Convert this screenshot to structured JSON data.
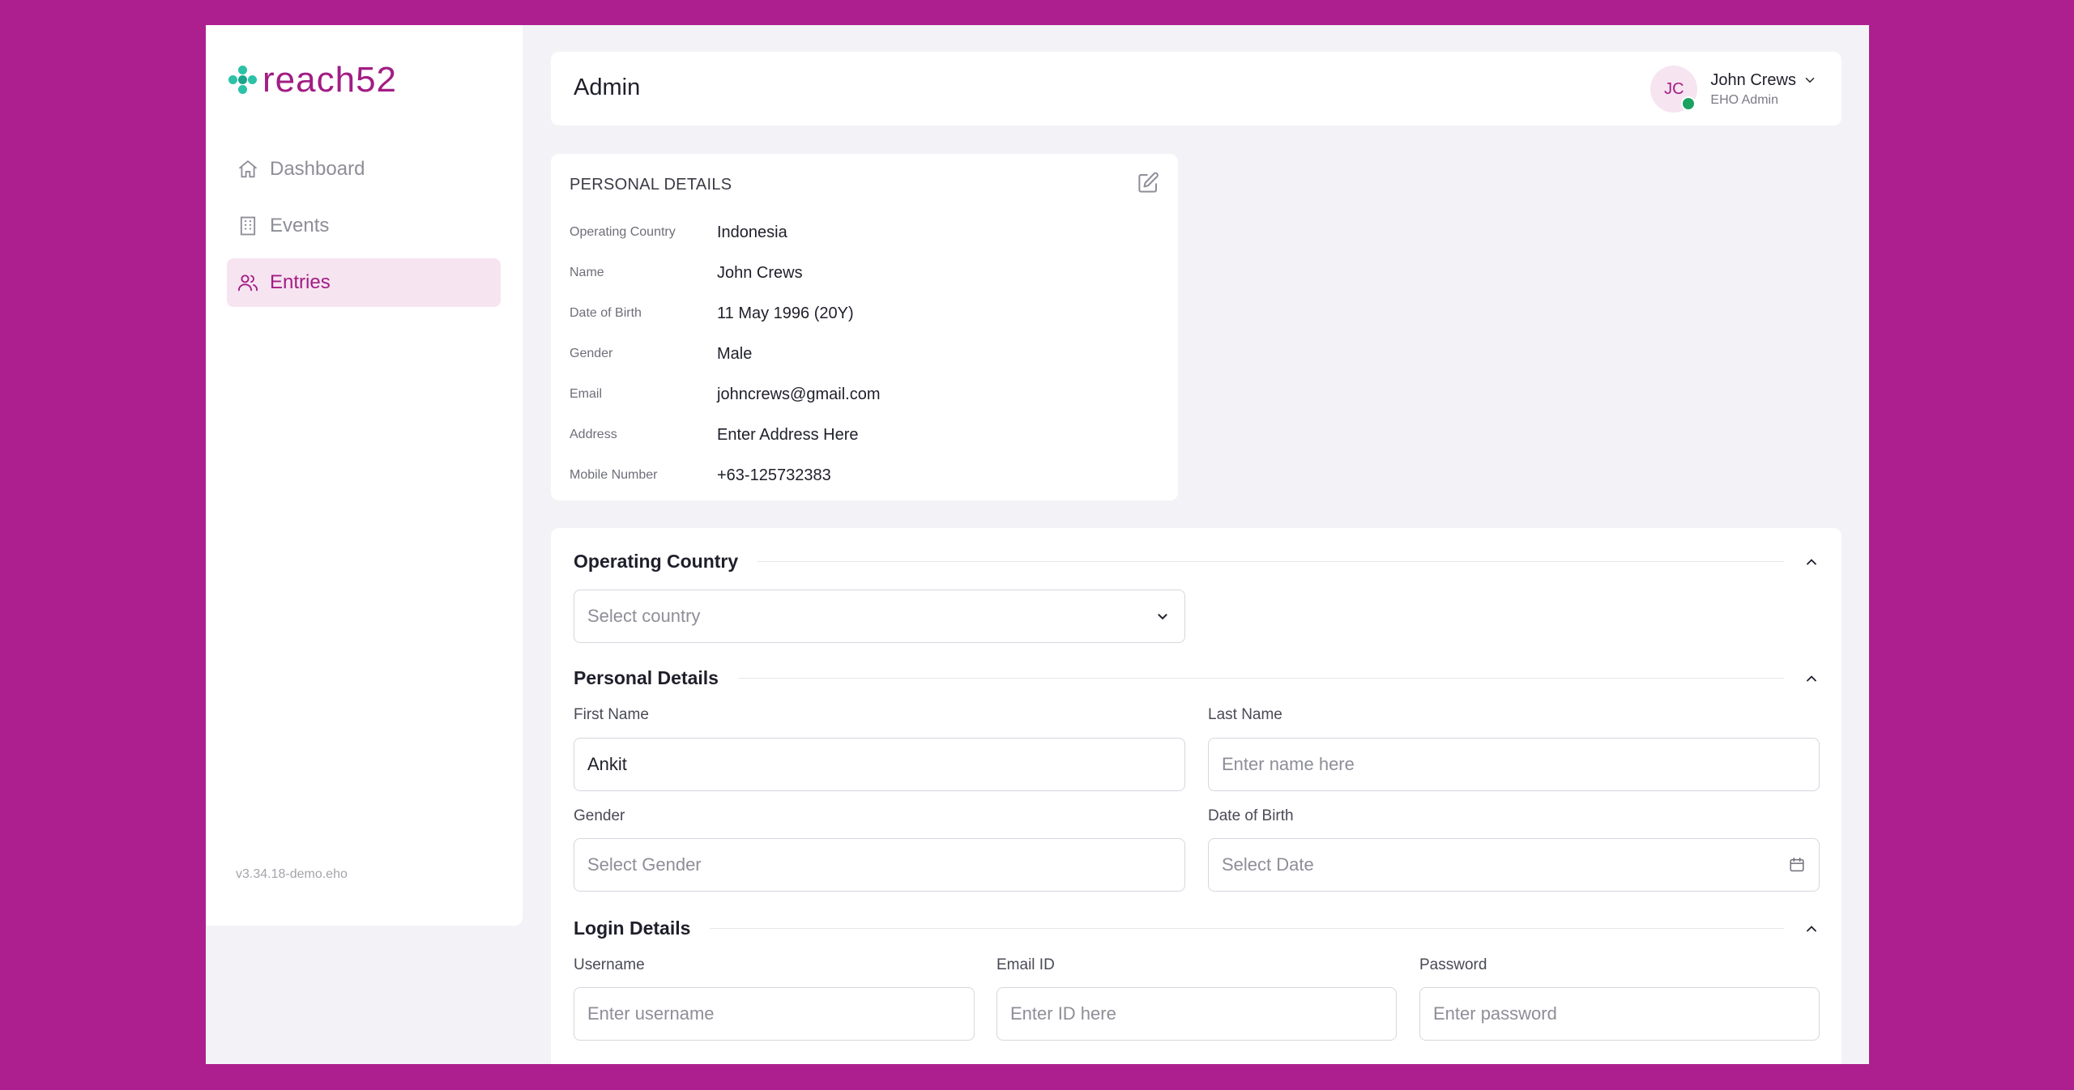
{
  "brand": {
    "name": "reach52",
    "accent": "#a21d84",
    "mark_color": "#2bc2a7"
  },
  "sidebar": {
    "items": [
      {
        "label": "Dashboard",
        "icon": "home-icon",
        "active": false
      },
      {
        "label": "Events",
        "icon": "building-icon",
        "active": false
      },
      {
        "label": "Entries",
        "icon": "users-icon",
        "active": true
      }
    ],
    "version": "v3.34.18-demo.eho"
  },
  "header": {
    "title": "Admin",
    "user": {
      "initials": "JC",
      "name": "John Crews",
      "role": "EHO Admin",
      "status": "online"
    }
  },
  "personal_details_card": {
    "title": "PERSONAL DETAILS",
    "rows": [
      {
        "label": "Operating Country",
        "value": "Indonesia"
      },
      {
        "label": "Name",
        "value": "John Crews"
      },
      {
        "label": "Date of Birth",
        "value": "11 May 1996 (20Y)"
      },
      {
        "label": "Gender",
        "value": "Male"
      },
      {
        "label": "Email",
        "value": "johncrews@gmail.com"
      },
      {
        "label": "Address",
        "value": "Enter Address Here"
      },
      {
        "label": "Mobile Number",
        "value": "+63-125732383"
      }
    ]
  },
  "form": {
    "operating_country": {
      "title": "Operating Country",
      "country_placeholder": "Select country"
    },
    "personal_details": {
      "title": "Personal Details",
      "first_name_label": "First Name",
      "first_name_value": "Ankit",
      "last_name_label": "Last Name",
      "last_name_placeholder": "Enter name here",
      "gender_label": "Gender",
      "gender_placeholder": "Select Gender",
      "dob_label": "Date of Birth",
      "dob_placeholder": "Select Date"
    },
    "login_details": {
      "title": "Login Details",
      "username_label": "Username",
      "username_placeholder": "Enter username",
      "email_label": "Email ID",
      "email_placeholder": "Enter ID here",
      "password_label": "Password",
      "password_placeholder": "Enter password"
    }
  }
}
